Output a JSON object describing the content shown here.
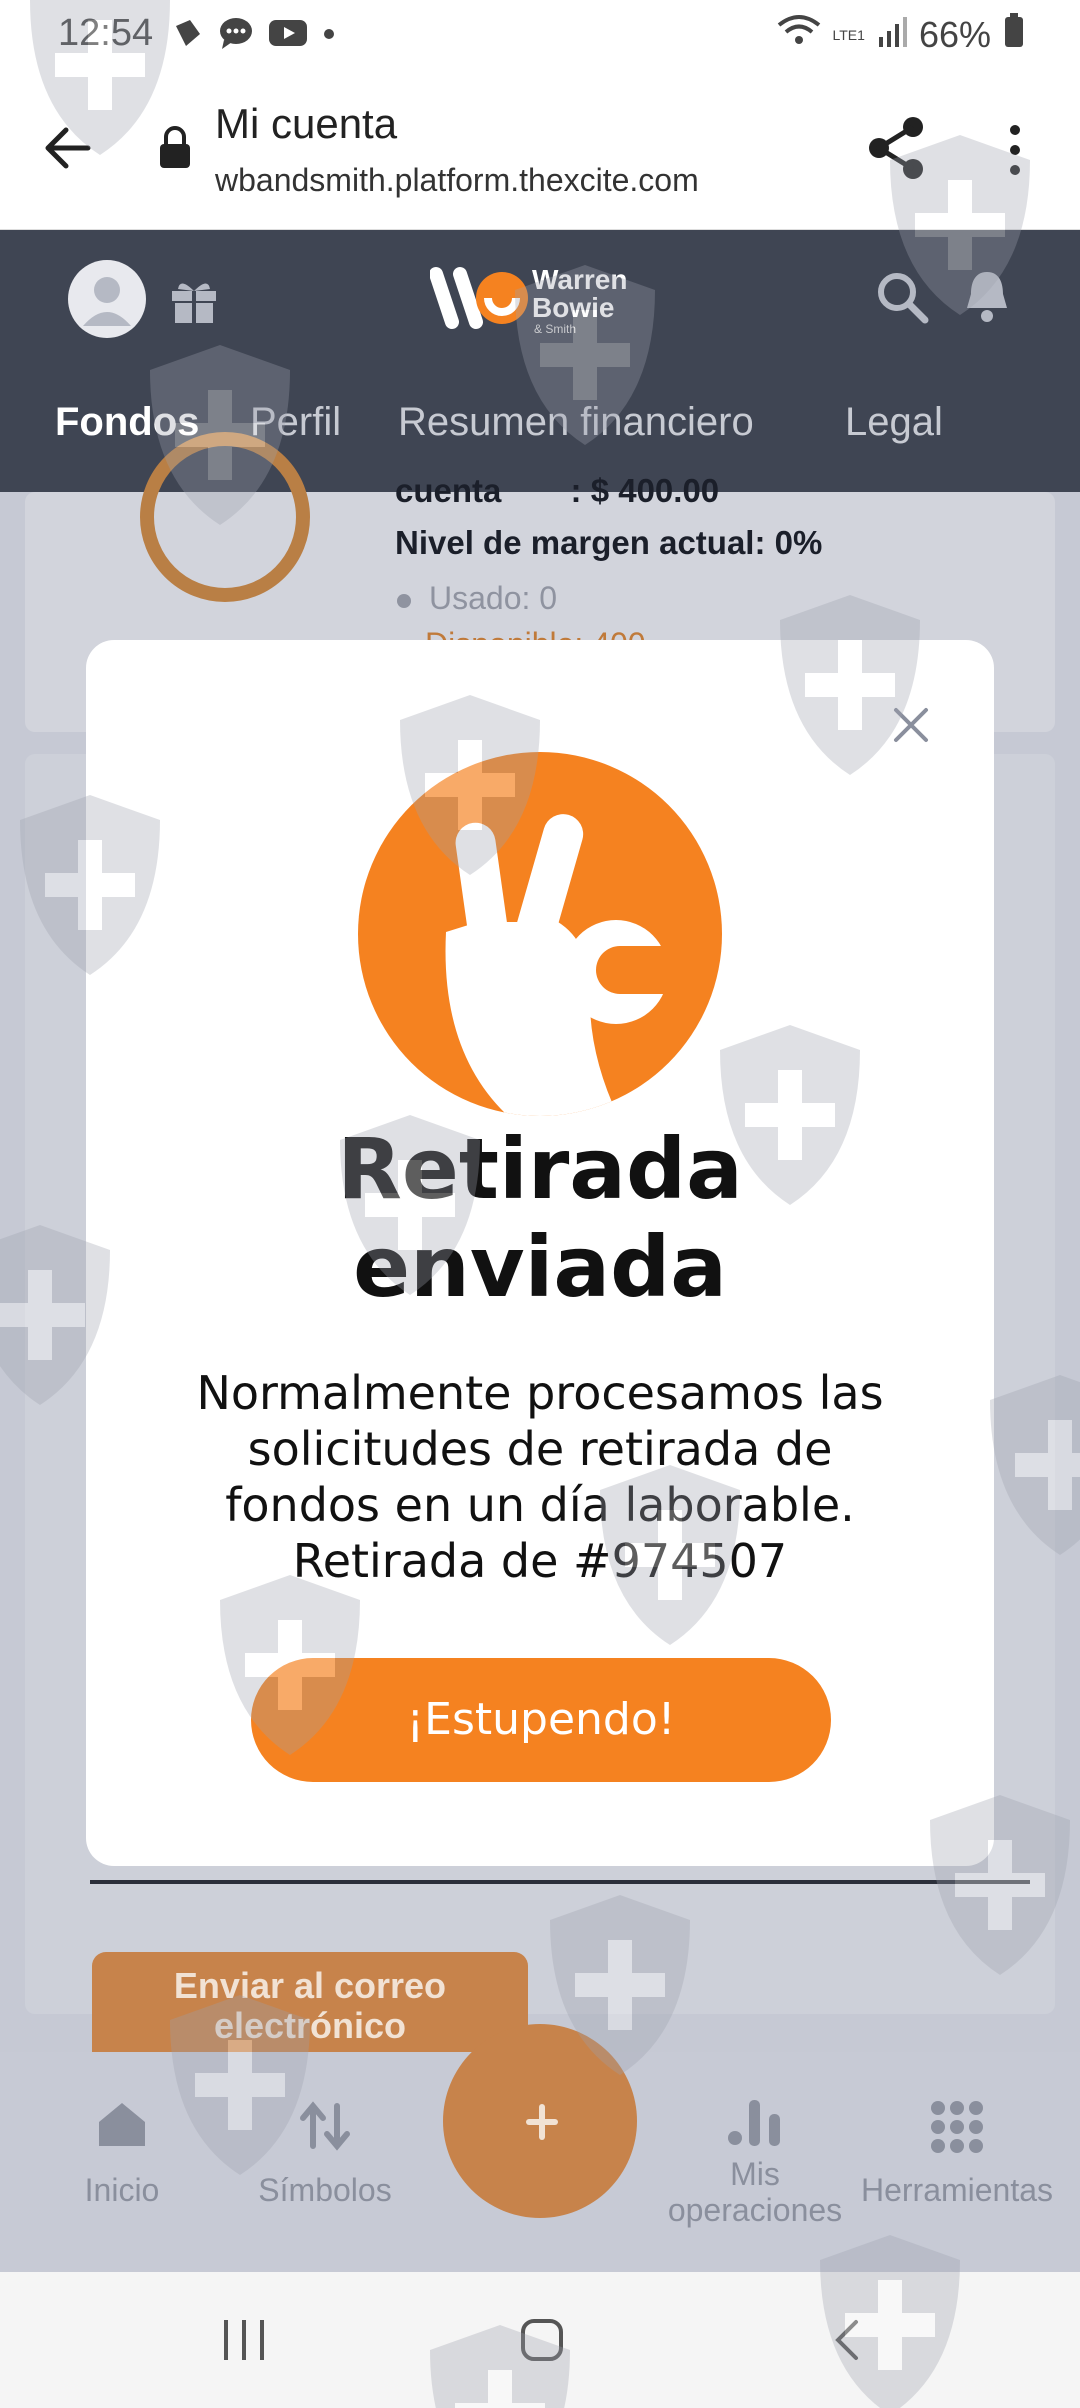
{
  "status_bar": {
    "time": "12:54",
    "battery": "66%",
    "network": "LTE1"
  },
  "browser": {
    "title": "Mi cuenta",
    "url": "wbandsmith.platform.thexcite.com"
  },
  "app_header": {
    "logo_line1": "Warren",
    "logo_line2": "Bowie",
    "logo_line3": "& Smith",
    "tabs": [
      {
        "label": "Fondos",
        "active": true
      },
      {
        "label": "Perfil",
        "active": false
      },
      {
        "label": "Resumen financiero",
        "active": false
      },
      {
        "label": "Legal",
        "active": false
      }
    ]
  },
  "account": {
    "balance_label": "cuenta",
    "balance_value": ": $ 400.00",
    "margin_label": "Nivel de margen actual: 0%",
    "used_label": "Usado: 0",
    "available_label": "Disponible: 400"
  },
  "email_button": {
    "line1": "Enviar al correo",
    "line2": "electrónico"
  },
  "modal": {
    "title_line1": "Retirada",
    "title_line2": "enviada",
    "body_lines": [
      "Normalmente procesamos las",
      "solicitudes de retirada de",
      "fondos en un día laborable.",
      "Retirada de #974507"
    ],
    "button_label": "¡Estupendo!"
  },
  "bottom_nav": {
    "items": [
      {
        "label": "Inicio",
        "icon": "home-icon"
      },
      {
        "label": "Símbolos",
        "icon": "swap-arrows-icon"
      },
      {
        "label": "",
        "icon": "plus-icon"
      },
      {
        "label": "Mis",
        "label2": "operaciones",
        "icon": "bar-chart-icon"
      },
      {
        "label": "Herramientas",
        "icon": "grid-dots-icon"
      }
    ]
  },
  "colors": {
    "accent": "#F58220",
    "header_bg": "#3F4553",
    "overlay_bg": "#C6C9D4"
  }
}
